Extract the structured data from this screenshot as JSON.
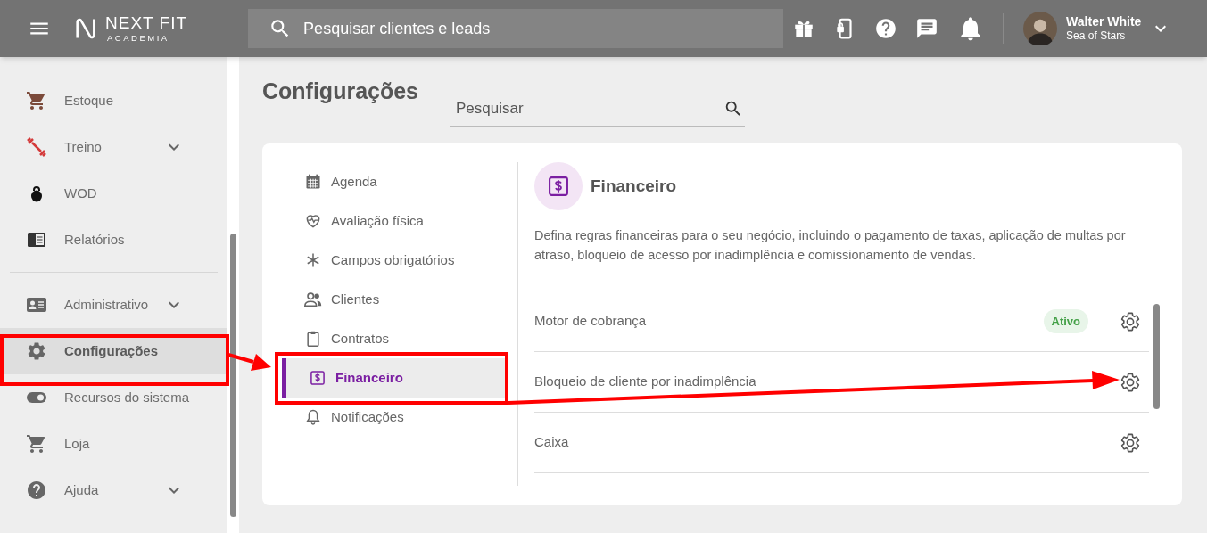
{
  "header": {
    "brand_name": "NEXT FIT",
    "brand_sub": "ACADEMIA",
    "search": {
      "placeholder": "Pesquisar clientes e leads"
    },
    "user": {
      "name": "Walter White",
      "subtitle": "Sea of Stars"
    }
  },
  "sidebar": {
    "groups": [
      [
        {
          "label": "Estoque",
          "expandable": false,
          "selected": false
        },
        {
          "label": "Treino",
          "expandable": true,
          "selected": false
        },
        {
          "label": "WOD",
          "expandable": false,
          "selected": false
        },
        {
          "label": "Relatórios",
          "expandable": false,
          "selected": false
        }
      ],
      [
        {
          "label": "Administrativo",
          "expandable": true,
          "selected": false
        },
        {
          "label": "Configurações",
          "expandable": false,
          "selected": true
        },
        {
          "label": "Recursos do sistema",
          "expandable": false,
          "selected": false
        },
        {
          "label": "Loja",
          "expandable": false,
          "selected": false
        },
        {
          "label": "Ajuda",
          "expandable": true,
          "selected": false
        }
      ]
    ]
  },
  "page": {
    "title": "Configurações",
    "search": {
      "placeholder": "Pesquisar"
    }
  },
  "settings_nav": [
    {
      "label": "Agenda",
      "selected": false
    },
    {
      "label": "Avaliação física",
      "selected": false
    },
    {
      "label": "Campos obrigatórios",
      "selected": false
    },
    {
      "label": "Clientes",
      "selected": false
    },
    {
      "label": "Contratos",
      "selected": false
    },
    {
      "label": "Financeiro",
      "selected": true
    },
    {
      "label": "Notificações",
      "selected": false
    }
  ],
  "panel": {
    "title": "Financeiro",
    "description": "Defina regras financeiras para o seu negócio, incluindo o pagamento de taxas, aplicação de multas por atraso, bloqueio de acesso por inadimplência e comissionamento de vendas.",
    "rows": [
      {
        "label": "Motor de cobrança",
        "status": "Ativo"
      },
      {
        "label": "Bloqueio de cliente por inadimplência"
      },
      {
        "label": "Caixa"
      }
    ]
  }
}
